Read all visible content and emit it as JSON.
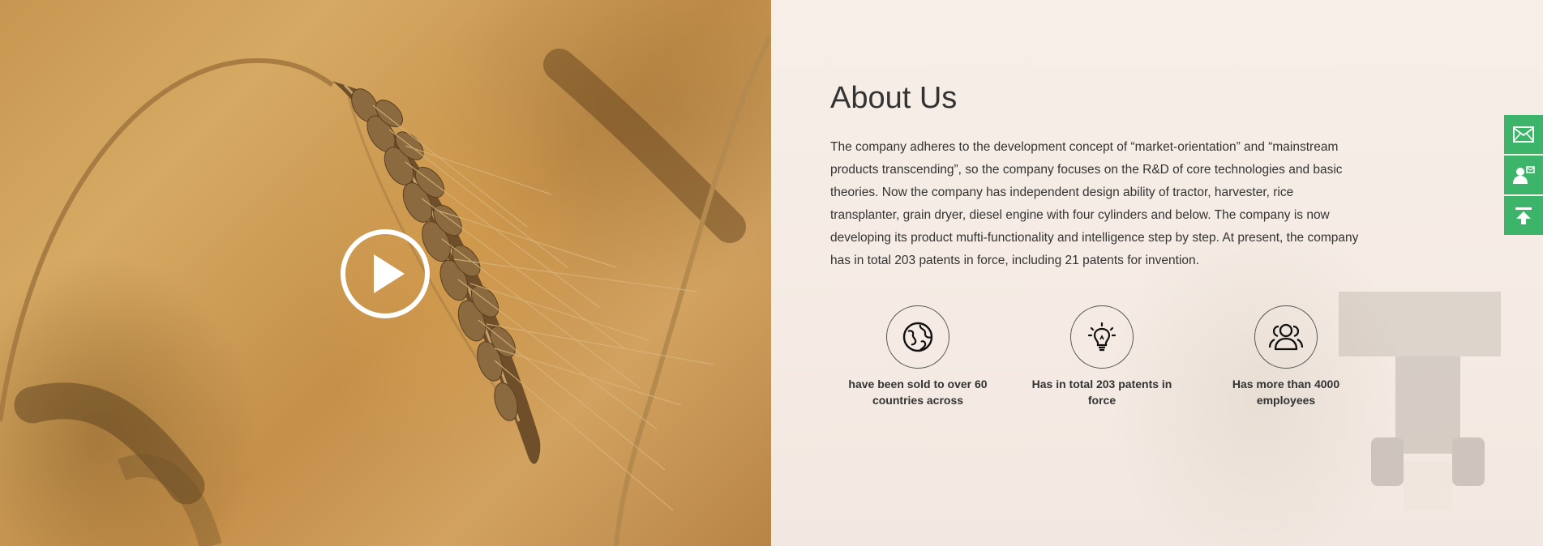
{
  "media": {
    "image": "wheat-ear-photo",
    "play_icon": "play-icon"
  },
  "about": {
    "title": "About Us",
    "description": "The company adheres to the development concept of “market-orientation” and “mainstream products transcending”, so the company focuses on the R&D of core technologies and basic theories. Now the company has independent design ability of tractor, harvester, rice transplanter, grain dryer, diesel engine with four cylinders and below. The company is now developing its product mufti-functionality and intelligence step by step. At present, the company has in total 203 patents in force, including 21 patents for invention.",
    "features": [
      {
        "icon": "globe-icon",
        "label": "have been sold to over 60 countries across"
      },
      {
        "icon": "lightbulb-icon",
        "label": "Has in total 203 patents in force"
      },
      {
        "icon": "people-icon",
        "label": "Has more than 4000 employees"
      }
    ]
  },
  "side_buttons": [
    {
      "icon": "mail-icon"
    },
    {
      "icon": "contact-icon"
    },
    {
      "icon": "back-to-top-icon"
    }
  ],
  "colors": {
    "accent": "#3cb56b",
    "text": "#333333",
    "panel_bg": "#f5ebe4"
  }
}
